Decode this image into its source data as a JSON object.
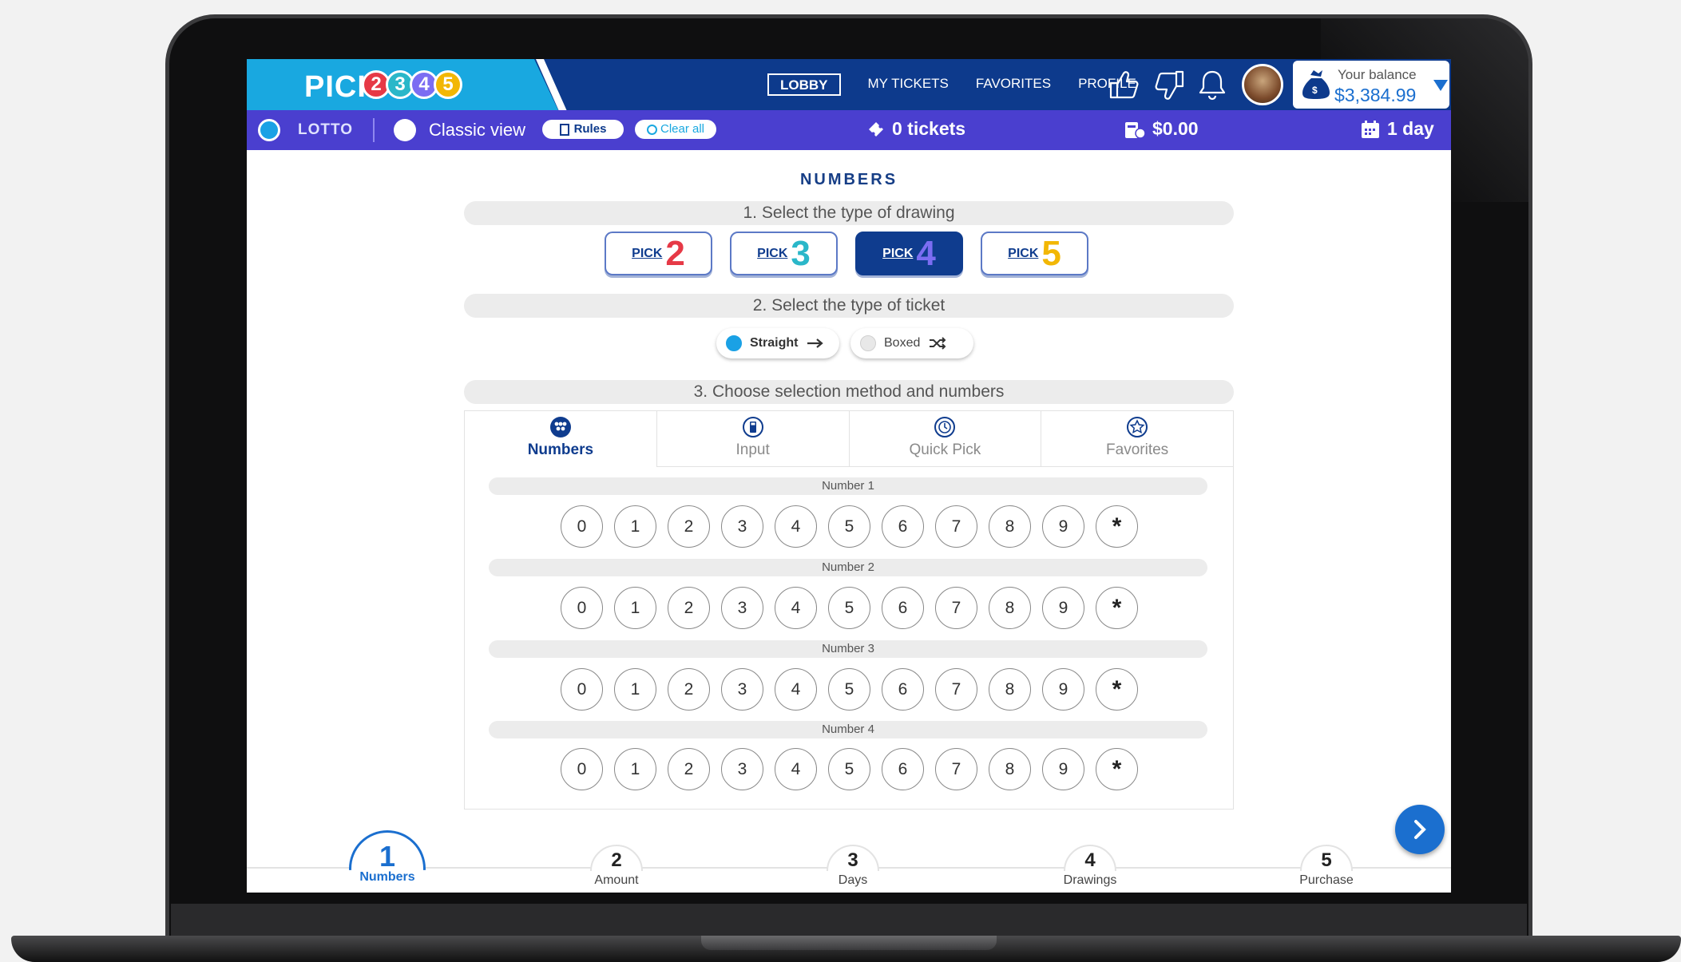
{
  "header": {
    "logo_word": "PICK",
    "logo_digits": [
      "2",
      "3",
      "4",
      "5"
    ],
    "nav": [
      {
        "label": "LOBBY",
        "active": true
      },
      {
        "label": "MY TICKETS",
        "active": false
      },
      {
        "label": "FAVORITES",
        "active": false
      },
      {
        "label": "PROFILE",
        "active": false
      }
    ],
    "icons": [
      "thumbs-up-icon",
      "thumbs-down-icon",
      "bell-icon"
    ],
    "balance_label": "Your balance",
    "balance_value": "$3,384.99"
  },
  "subbar": {
    "lotto_label": "LOTTO",
    "classic_view_label": "Classic view",
    "rules_label": "Rules",
    "clear_all_label": "Clear all",
    "tickets_label": "0 tickets",
    "amount_label": "$0.00",
    "days_label": "1 day"
  },
  "main": {
    "section_title": "NUMBERS",
    "step1_label": "1. Select the type of drawing",
    "picks": [
      {
        "word": "PICK",
        "digit": "2",
        "color": "#e63946",
        "selected": false
      },
      {
        "word": "PICK",
        "digit": "3",
        "color": "#2ab7c9",
        "selected": false
      },
      {
        "word": "PICK",
        "digit": "4",
        "color": "#7b6df2",
        "selected": true
      },
      {
        "word": "PICK",
        "digit": "5",
        "color": "#f2b705",
        "selected": false
      }
    ],
    "step2_label": "2. Select the type of ticket",
    "ticket_types": [
      {
        "label": "Straight",
        "selected": true
      },
      {
        "label": "Boxed",
        "selected": false
      }
    ],
    "step3_label": "3. Choose selection method and numbers",
    "tabs": [
      {
        "label": "Numbers",
        "active": true,
        "icon": "dots-icon"
      },
      {
        "label": "Input",
        "active": false,
        "icon": "calculator-icon"
      },
      {
        "label": "Quick Pick",
        "active": false,
        "icon": "clock-icon"
      },
      {
        "label": "Favorites",
        "active": false,
        "icon": "star-icon"
      }
    ],
    "number_groups": [
      {
        "label": "Number 1",
        "values": [
          "0",
          "1",
          "2",
          "3",
          "4",
          "5",
          "6",
          "7",
          "8",
          "9",
          "*"
        ]
      },
      {
        "label": "Number 2",
        "values": [
          "0",
          "1",
          "2",
          "3",
          "4",
          "5",
          "6",
          "7",
          "8",
          "9",
          "*"
        ]
      },
      {
        "label": "Number 3",
        "values": [
          "0",
          "1",
          "2",
          "3",
          "4",
          "5",
          "6",
          "7",
          "8",
          "9",
          "*"
        ]
      },
      {
        "label": "Number 4",
        "values": [
          "0",
          "1",
          "2",
          "3",
          "4",
          "5",
          "6",
          "7",
          "8",
          "9",
          "*"
        ]
      }
    ]
  },
  "stepper": [
    {
      "number": "1",
      "label": "Numbers",
      "active": true
    },
    {
      "number": "2",
      "label": "Amount",
      "active": false
    },
    {
      "number": "3",
      "label": "Days",
      "active": false
    },
    {
      "number": "4",
      "label": "Drawings",
      "active": false
    },
    {
      "number": "5",
      "label": "Purchase",
      "active": false
    }
  ],
  "colors": {
    "topbar": "#0d3a8c",
    "logo_bg": "#19a8e0",
    "subbar": "#4a3fcf",
    "accent": "#1b6fcf"
  }
}
